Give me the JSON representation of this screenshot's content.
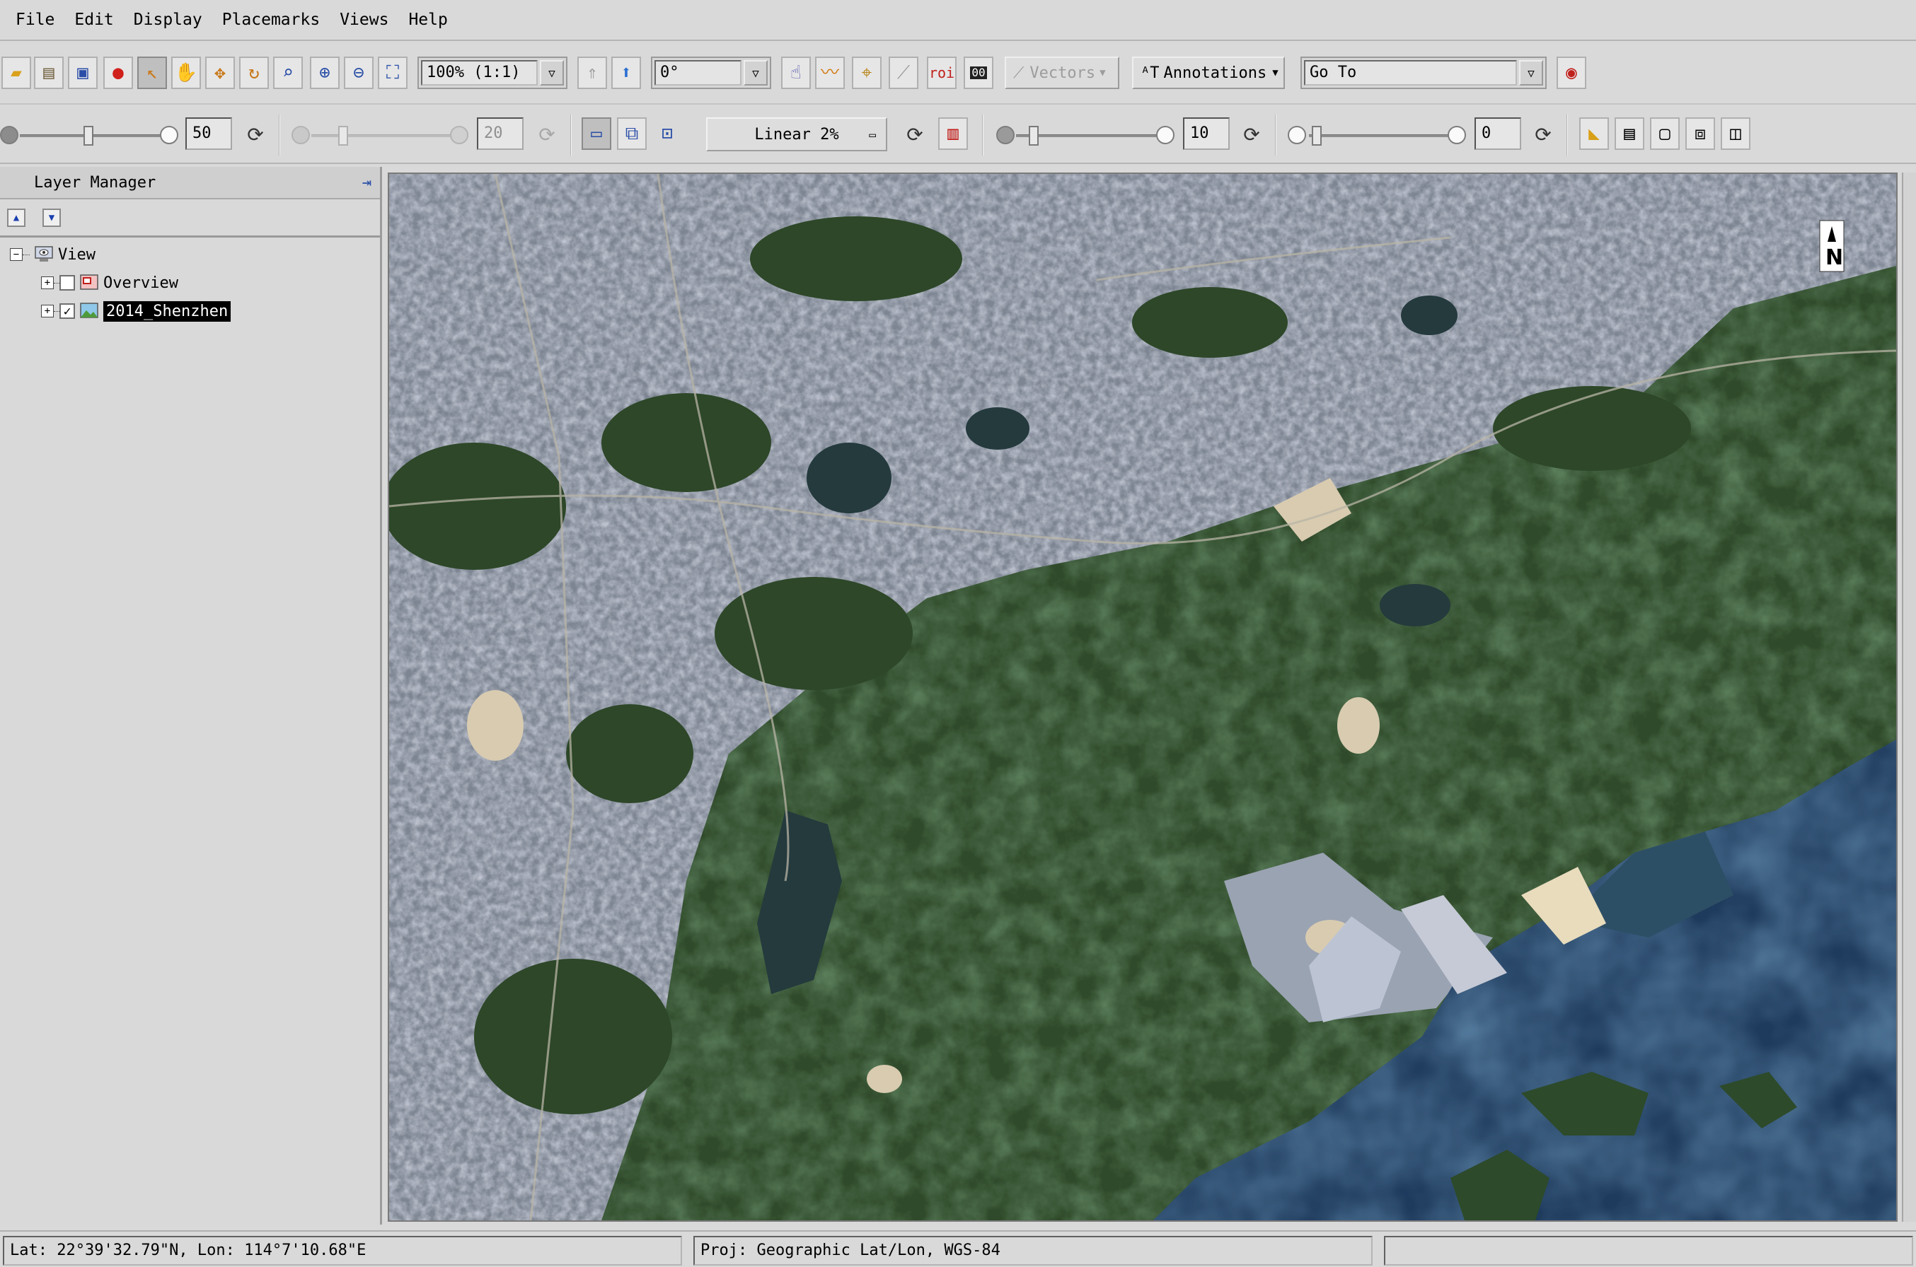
{
  "menu": [
    "File",
    "Edit",
    "Display",
    "Placemarks",
    "Views",
    "Help"
  ],
  "toolbar": {
    "zoom_value": "100% (1:1)",
    "rotation_value": "0°",
    "vectors_label": "Vectors",
    "annotations_label": "Annotations",
    "goto_value": "Go To",
    "icons": [
      "open-icon",
      "clipboard-icon",
      "crop-icon",
      "placemark-icon",
      "select-icon",
      "pan-icon",
      "fly-icon",
      "rotate-icon",
      "zoom-tool-icon",
      "zoom-in-icon",
      "zoom-out-icon",
      "zoom-fit-icon"
    ]
  },
  "enhance": {
    "brightness_value": "50",
    "contrast_value": "20",
    "stretch_label": "Linear 2%",
    "sharpen_value": "10",
    "transparency_value": "0"
  },
  "layer_manager": {
    "title": "Layer Manager",
    "root_label": "View",
    "layers": [
      {
        "label": "Overview",
        "checked": false
      },
      {
        "label": "2014_Shenzhen",
        "checked": true,
        "selected": true
      }
    ]
  },
  "map": {
    "north_label": "N",
    "colors": {
      "vegetation": "#2f4a2a",
      "urban": "#8a93a3",
      "sea": "#1e3a5c",
      "water_dark": "#243a3d"
    }
  },
  "status": {
    "coords": "Lat: 22°39'32.79\"N, Lon: 114°7'10.68\"E",
    "projection": "Proj: Geographic Lat/Lon, WGS-84",
    "extra": ""
  }
}
